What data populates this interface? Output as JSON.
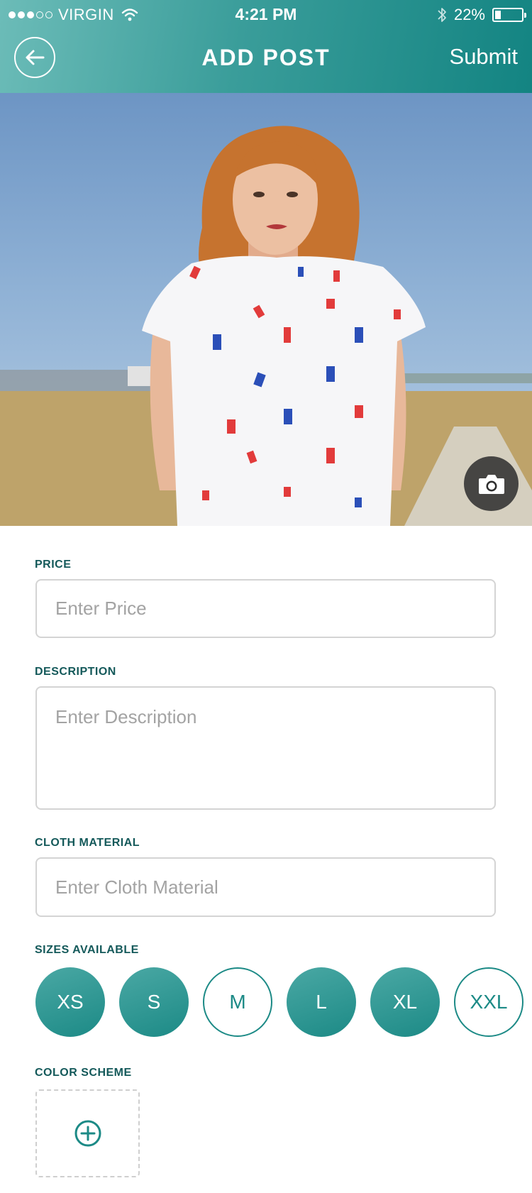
{
  "status_bar": {
    "carrier": "VIRGIN",
    "time": "4:21 PM",
    "battery": "22%",
    "battery_level": 0.22,
    "signal_bars": 3,
    "icons": [
      "signal-dots-icon",
      "wifi-icon",
      "bluetooth-icon",
      "battery-icon"
    ]
  },
  "header": {
    "title": "ADD POST",
    "submit_label": "Submit",
    "back_icon": "arrow-left-icon",
    "gradient": [
      "#6cbcb8",
      "#138482"
    ]
  },
  "photo": {
    "camera_icon": "camera-icon"
  },
  "form": {
    "price": {
      "label": "PRICE",
      "placeholder": "Enter Price",
      "value": ""
    },
    "description": {
      "label": "DESCRIPTION",
      "placeholder": "Enter Description",
      "value": ""
    },
    "material": {
      "label": "CLOTH MATERIAL",
      "placeholder": "Enter Cloth Material",
      "value": ""
    },
    "sizes": {
      "label": "SIZES AVAILABLE",
      "items": [
        {
          "label": "XS",
          "selected": true
        },
        {
          "label": "S",
          "selected": true
        },
        {
          "label": "M",
          "selected": false
        },
        {
          "label": "L",
          "selected": true
        },
        {
          "label": "XL",
          "selected": true
        },
        {
          "label": "XXL",
          "selected": false
        }
      ]
    },
    "color_scheme": {
      "label": "COLOR SCHEME",
      "add_icon": "plus-circle-icon"
    }
  },
  "colors": {
    "accent": "#1c8a86",
    "label_text": "#14595a",
    "border": "#d4d4d4",
    "placeholder": "#a3a3a3"
  }
}
